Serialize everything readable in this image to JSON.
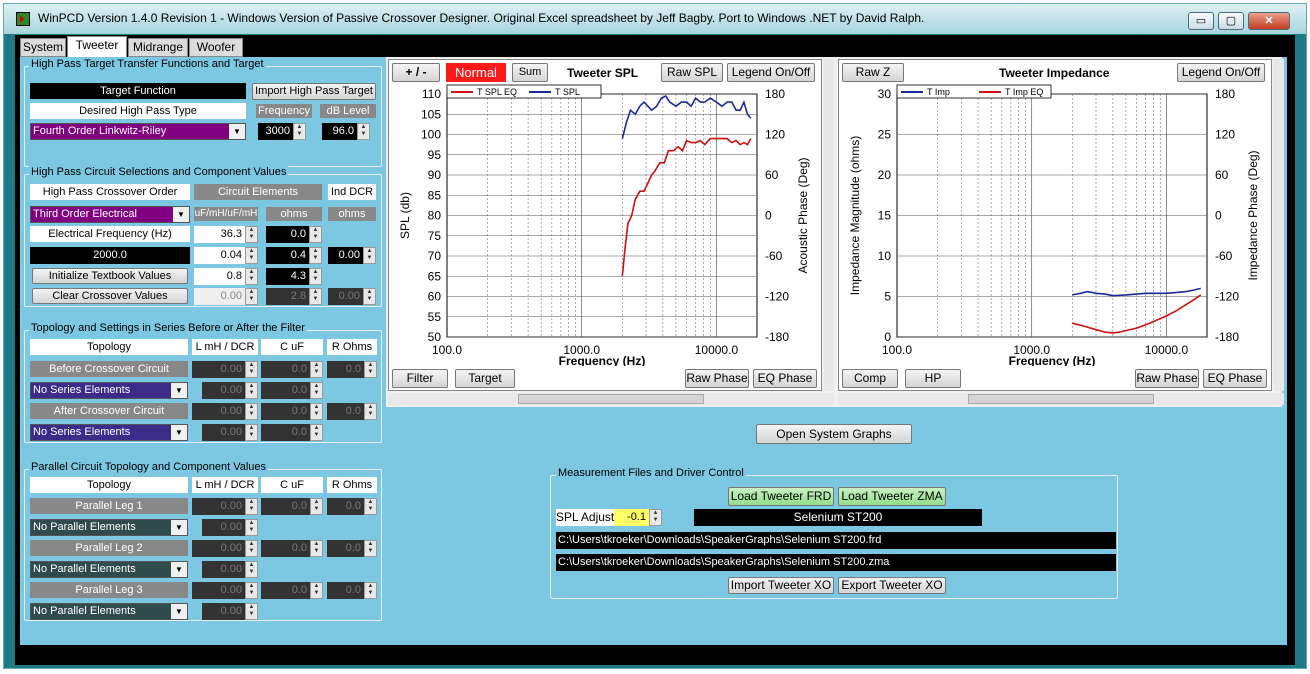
{
  "window": {
    "title": "WinPCD Version 1.4.0 Revision 1 - Windows Version of Passive Crossover Designer. Original Excel spreadsheet by Jeff Bagby. Port to Windows .NET by David Ralph.",
    "min_glyph": "▭",
    "max_glyph": "▢",
    "close_glyph": "✕"
  },
  "tabs": [
    "System",
    "Tweeter",
    "Midrange",
    "Woofer"
  ],
  "highpass_target": {
    "group_label": "High Pass Target Transfer Functions and Target",
    "target_function_label": "Target Function",
    "import_button": "Import High Pass Target",
    "desired_type_label": "Desired High Pass Type",
    "frequency_label": "Frequency",
    "db_level_label": "dB Level",
    "type_value": "Fourth Order Linkwitz-Riley",
    "frequency_value": "3000",
    "db_level_value": "96.0"
  },
  "circuit": {
    "group_label": "High Pass Circuit Selections and Component Values",
    "order_label": "High Pass Crossover Order",
    "elements_label": "Circuit Elements",
    "ind_dcr_label": "Ind DCR",
    "order_value": "Third Order Electrical",
    "units_label": "uF/mH/uF/mH",
    "ohms_label_1": "ohms",
    "ohms_label_2": "ohms",
    "elec_freq_label": "Electrical Frequency (Hz)",
    "elec_freq_value": "36.3",
    "freq_display": "2000.0",
    "init_button": "Initialize Textbook Values",
    "clear_button": "Clear Crossover Values",
    "values": [
      "36.3",
      "0.04",
      "0.8",
      "0.00"
    ],
    "ohms_values": [
      "0.0",
      "0.4",
      "4.3",
      "2.8"
    ],
    "dcr_values": [
      "0.00",
      "0.00"
    ]
  },
  "topology": {
    "group_label": "Topology and Settings in Series Before or After the Filter",
    "headers": [
      "Topology",
      "L mH / DCR",
      "C uF",
      "R Ohms"
    ],
    "before_label": "Before Crossover Circuit",
    "after_label": "After Crossover Circuit",
    "series_value_1": "No Series Elements",
    "series_value_2": "No Series Elements",
    "zero": "0.00",
    "zero1": "0.0"
  },
  "parallel": {
    "group_label": "Parallel Circuit Topology and Component Values",
    "headers": [
      "Topology",
      "L mH / DCR",
      "C uF",
      "R Ohms"
    ],
    "legs": [
      {
        "label": "Parallel Leg 1",
        "select": "No Parallel Elements"
      },
      {
        "label": "Parallel Leg 2",
        "select": "No Parallel Elements"
      },
      {
        "label": "Parallel Leg 3",
        "select": "No Parallel Elements"
      }
    ],
    "zero": "0.00",
    "zero1": "0.0"
  },
  "spl_graph": {
    "title": "Tweeter SPL",
    "btn_plusminus": "+ / -",
    "btn_normal": "Normal",
    "btn_sum": "Sum",
    "btn_raw": "Raw SPL",
    "btn_legend": "Legend On/Off",
    "btn_filter": "Filter",
    "btn_target": "Target",
    "btn_rawphase": "Raw Phase",
    "btn_eqphase": "EQ Phase",
    "legend": [
      "T SPL EQ",
      "T SPL"
    ],
    "ylabel": "SPL (db)",
    "y2label": "Acoustic Phase (Deg)",
    "xlabel": "Frequency (Hz)"
  },
  "imp_graph": {
    "title": "Tweeter Impedance",
    "btn_raw": "Raw Z",
    "btn_legend": "Legend On/Off",
    "btn_comp": "Comp",
    "btn_hp": "HP",
    "btn_rawphase": "Raw Phase",
    "btn_eqphase": "EQ Phase",
    "legend": [
      "T Imp",
      "T Imp EQ"
    ],
    "ylabel": "Impedance Magnitude (ohms)",
    "y2label": "Impedance Phase (Deg)",
    "xlabel": "Frequency (Hz)"
  },
  "chart_data": [
    {
      "type": "line",
      "title": "Tweeter SPL",
      "xlabel": "Frequency (Hz)",
      "ylabel": "SPL (db)",
      "y2label": "Acoustic Phase (Deg)",
      "xscale": "log",
      "xlim": [
        100,
        20000
      ],
      "ylim": [
        50,
        110
      ],
      "y2lim": [
        -180,
        180
      ],
      "xticks": [
        "100.0",
        "1000.0",
        "10000.0"
      ],
      "yticks": [
        "50",
        "55",
        "60",
        "65",
        "70",
        "75",
        "80",
        "85",
        "90",
        "95",
        "100",
        "105",
        "110"
      ],
      "y2ticks": [
        "180",
        "120",
        "60",
        "0",
        "-60",
        "-120",
        "-180"
      ],
      "grid": true,
      "legend_position": "top-left",
      "series": [
        {
          "name": "T SPL EQ",
          "color": "#cc1111",
          "x": [
            2000,
            2100,
            2200,
            2350,
            2500,
            2700,
            2900,
            3100,
            3300,
            3500,
            3800,
            4100,
            4400,
            4800,
            5200,
            5600,
            6000,
            6500,
            7000,
            7600,
            8200,
            9000,
            10000,
            11000,
            12000,
            13000,
            14000,
            15000,
            16000,
            17000,
            18000
          ],
          "y": [
            65,
            72,
            78,
            80,
            84,
            86,
            86,
            88,
            90,
            91,
            93,
            93,
            96,
            96,
            97,
            96,
            98.5,
            98,
            98,
            98.5,
            97.5,
            99,
            99,
            99,
            99,
            98,
            98.5,
            97.5,
            98,
            97.5,
            99
          ]
        },
        {
          "name": "T SPL",
          "color": "#1a2a99",
          "x": [
            2000,
            2150,
            2300,
            2500,
            2700,
            2900,
            3100,
            3300,
            3600,
            3900,
            4200,
            4500,
            5000,
            5500,
            6000,
            6500,
            7000,
            7600,
            8200,
            9000,
            10000,
            11000,
            12000,
            13000,
            14000,
            15000,
            16000,
            17000,
            18000
          ],
          "y": [
            99,
            103,
            106,
            105,
            107,
            108,
            107,
            106,
            107,
            109,
            109.5,
            108,
            107,
            108,
            108,
            107,
            109,
            108,
            108,
            109,
            108,
            107,
            108,
            108,
            106,
            106,
            108,
            105,
            104
          ]
        }
      ]
    },
    {
      "type": "line",
      "title": "Tweeter Impedance",
      "xlabel": "Frequency (Hz)",
      "ylabel": "Impedance Magnitude (ohms)",
      "y2label": "Impedance Phase (Deg)",
      "xscale": "log",
      "xlim": [
        100,
        20000
      ],
      "ylim": [
        0,
        30
      ],
      "y2lim": [
        -180,
        180
      ],
      "xticks": [
        "100.0",
        "1000.0",
        "10000.0"
      ],
      "yticks": [
        "0",
        "5",
        "10",
        "15",
        "20",
        "25",
        "30"
      ],
      "y2ticks": [
        "180",
        "120",
        "60",
        "0",
        "-60",
        "-120",
        "-180"
      ],
      "grid": true,
      "legend_position": "top-left",
      "series": [
        {
          "name": "T Imp",
          "color": "#1a2a99",
          "x": [
            2000,
            2300,
            2600,
            3000,
            3500,
            4000,
            5000,
            6000,
            7000,
            8000,
            10000,
            12000,
            14000,
            16000,
            18000
          ],
          "y": [
            5.2,
            5.4,
            5.6,
            5.4,
            5.3,
            5.1,
            5.2,
            5.3,
            5.4,
            5.4,
            5.4,
            5.5,
            5.6,
            5.8,
            6.0
          ]
        },
        {
          "name": "T Imp EQ",
          "color": "#cc1111",
          "x": [
            2000,
            2500,
            3000,
            3500,
            4000,
            4500,
            5000,
            6000,
            7000,
            8000,
            10000,
            12000,
            14000,
            16000,
            18000
          ],
          "y": [
            1.7,
            1.3,
            0.9,
            0.6,
            0.5,
            0.6,
            0.8,
            1.1,
            1.5,
            1.9,
            2.6,
            3.3,
            4.0,
            4.6,
            5.2
          ]
        }
      ]
    }
  ],
  "open_system_button": "Open System Graphs",
  "measurement": {
    "group_label": "Measurement Files and Driver Control",
    "load_frd": "Load Tweeter FRD",
    "load_zma": "Load Tweeter ZMA",
    "spl_adjust_label": "SPL Adjust",
    "spl_adjust_value": "-0.1",
    "driver_name": "Selenium ST200",
    "frd_path": "C:\\Users\\tkroeker\\Downloads\\SpeakerGraphs\\Selenium ST200.frd",
    "zma_path": "C:\\Users\\tkroeker\\Downloads\\SpeakerGraphs\\Selenium ST200.zma",
    "import_xo": "Import Tweeter XO",
    "export_xo": "Export Tweeter XO"
  },
  "colors": {
    "panel": "#7cc8e2",
    "purple_select": "#800080",
    "indigo_select": "#3b2c8a",
    "slate_select": "#2f4b4b",
    "normal_red": "#ff1a1a",
    "spl_yellow": "#ffff66"
  }
}
